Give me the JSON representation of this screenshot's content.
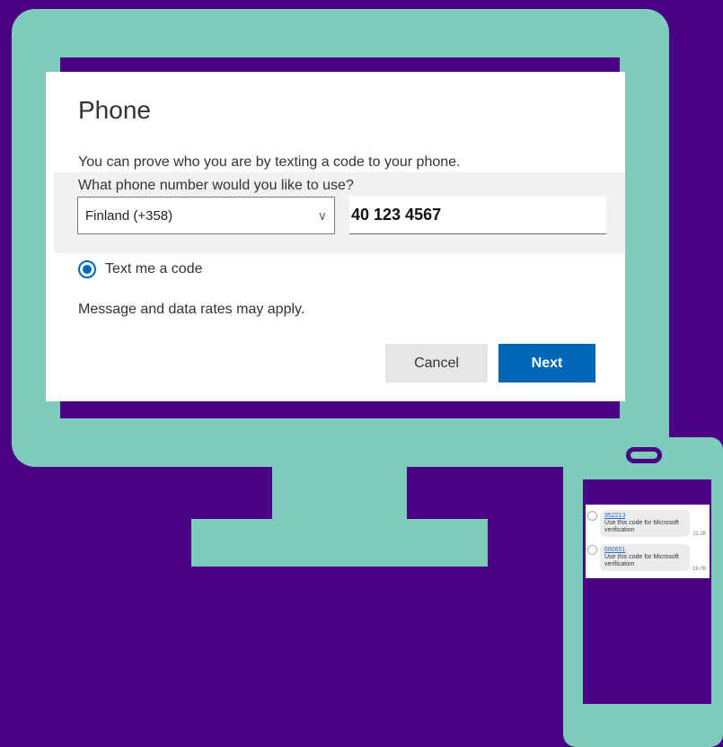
{
  "dialog": {
    "title": "Phone",
    "description": "You can prove who you are by texting a code to your phone.",
    "question": "What phone number would you like to use?",
    "country_select": {
      "value": "Finland (+358)"
    },
    "phone_input": {
      "value": "40 123 4567"
    },
    "radio_label": "Text me a code",
    "rates_note": "Message and data rates may apply.",
    "cancel_label": "Cancel",
    "next_label": "Next"
  },
  "phone": {
    "messages": [
      {
        "code": "952213",
        "text": "Use this code for Microsoft verification",
        "time": "11.28"
      },
      {
        "code": "680651",
        "text": "Use this code for Microsoft verification",
        "time": "16.09"
      }
    ]
  },
  "colors": {
    "background": "#4b0082",
    "device": "#7fcbbd",
    "accent": "#0067b8"
  },
  "icons": [
    "chevron-down-icon",
    "radio-selected-icon",
    "phone-speaker-icon",
    "contact-avatar-icon"
  ]
}
